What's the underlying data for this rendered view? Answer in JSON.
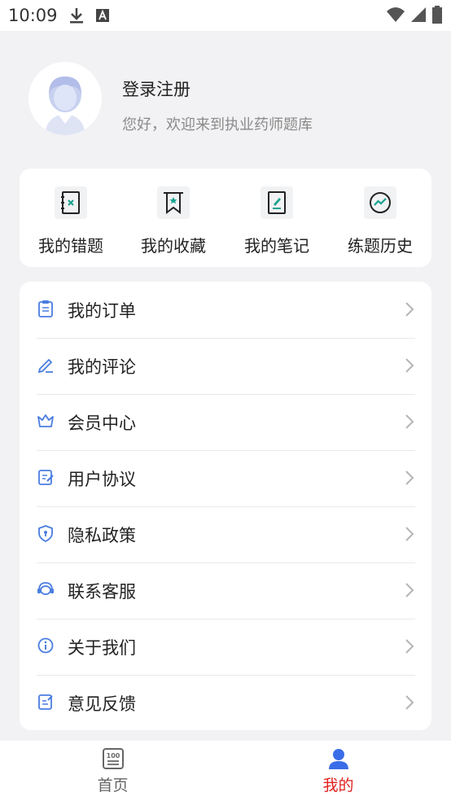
{
  "status_bar": {
    "time": "10:09",
    "icons": [
      "download-icon",
      "a-badge-icon",
      "wifi-icon",
      "signal-icon",
      "battery-icon"
    ]
  },
  "profile": {
    "title": "登录注册",
    "subtitle": "您好，欢迎来到执业药师题库"
  },
  "quick_actions": [
    {
      "label": "我的错题",
      "icon": "wrong-questions-icon"
    },
    {
      "label": "我的收藏",
      "icon": "bookmark-icon"
    },
    {
      "label": "我的笔记",
      "icon": "notes-icon"
    },
    {
      "label": "练题历史",
      "icon": "history-chart-icon"
    }
  ],
  "menu": [
    {
      "label": "我的订单",
      "icon": "clipboard-icon"
    },
    {
      "label": "我的评论",
      "icon": "edit-pen-icon"
    },
    {
      "label": "会员中心",
      "icon": "crown-icon"
    },
    {
      "label": "用户协议",
      "icon": "document-edit-icon"
    },
    {
      "label": "隐私政策",
      "icon": "shield-icon"
    },
    {
      "label": "联系客服",
      "icon": "headset-icon"
    },
    {
      "label": "关于我们",
      "icon": "info-icon"
    },
    {
      "label": "意见反馈",
      "icon": "feedback-icon"
    }
  ],
  "tab_bar": {
    "home": {
      "label": "首页",
      "icon": "home-100-icon"
    },
    "mine": {
      "label": "我的",
      "icon": "user-icon",
      "selected": true
    }
  },
  "colors": {
    "accent_blue": "#4a7de0",
    "tab_active": "#e02020",
    "teal": "#1aa38f"
  }
}
